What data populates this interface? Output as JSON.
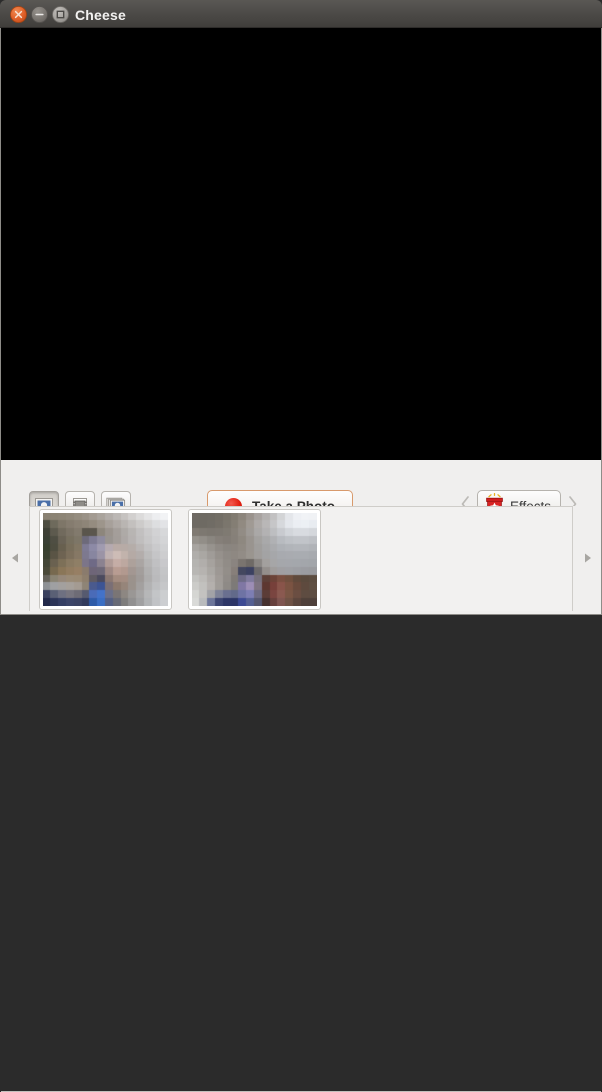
{
  "window": {
    "title": "Cheese",
    "controls": [
      {
        "name": "close",
        "glyph": "×",
        "color": "#e8632a"
      },
      {
        "name": "minimize",
        "glyph": "−",
        "color": "#7d7b77"
      },
      {
        "name": "maximize",
        "glyph": "□",
        "color": "#a9a7a3"
      }
    ]
  },
  "preview": {
    "background_color": "#000000",
    "state": ""
  },
  "toolbar": {
    "modes": [
      {
        "id": "photo",
        "label": "Photo",
        "icon": "photo-icon",
        "active": true
      },
      {
        "id": "video",
        "label": "Video",
        "icon": "video-icon",
        "active": false
      },
      {
        "id": "burst",
        "label": "Burst",
        "icon": "burst-icon",
        "active": false
      }
    ],
    "capture": {
      "label": "Take a Photo",
      "icon": "record-dot-icon",
      "accent_color": "#e21f10",
      "border_color": "#d89a6c"
    },
    "effects": {
      "label": "Effects",
      "icon": "effects-box-icon",
      "prev_icon": "chevron-left-icon",
      "next_icon": "chevron-right-icon"
    }
  },
  "thumbnails": {
    "scroll_left_icon": "triangle-left-icon",
    "scroll_right_icon": "triangle-right-icon",
    "items": [
      {
        "name": "photo-thumbnail-1",
        "cols": 16,
        "rows": 12,
        "pixels": [
          "8a8273",
          "8b8374",
          "8d8576",
          "90887a",
          "958d80",
          "9a9287",
          "a39b92",
          "aaa49d",
          "b3aeaa",
          "bcb8b5",
          "c6c3c1",
          "d2d0cf",
          "dcdbdb",
          "e5e5e6",
          "edeef0",
          "f2f3f5",
          "4c4d41",
          "6e6a5c",
          "7e7668",
          "857c6f",
          "8a8174",
          "8e8578",
          "958c80",
          "9d958b",
          "a7a09a",
          "b0aaa6",
          "b9b5b2",
          "c3c0be",
          "cdcbca",
          "d6d5d5",
          "dddee0",
          "e2e3e6",
          "3d4036",
          "5d5a4e",
          "716a5d",
          "7b7366",
          "827a6d",
          "5a554c",
          "5b564d",
          "8d867c",
          "9a938d",
          "a49e9a",
          "aeaaa7",
          "b8b5b3",
          "c2c0c0",
          "cbcacb",
          "d2d2d4",
          "d7d8da",
          "394035",
          "4f4e43",
          "6a6356",
          "77705f",
          "7d7667",
          "6d6a7a",
          "7d7a92",
          "8e8b9f",
          "999490",
          "a39d99",
          "ada8a6",
          "b7b3b2",
          "c0bebe",
          "c8c7c8",
          "cfcfd1",
          "d4d5d7",
          "37402f",
          "4e4d40",
          "68604f",
          "786e5b",
          "827764",
          "7e7b94",
          "8d8aa6",
          "a09bb0",
          "b5aab0",
          "b9aba6",
          "b7aba6",
          "b5ada9",
          "bab6b5",
          "c2c1c2",
          "cacacc",
          "d0d1d3",
          "3a4131",
          "5a5445",
          "6e6352",
          "7c6f5c",
          "867865",
          "7d798f",
          "8886a0",
          "9b94a6",
          "c0b2b2",
          "cdbcb6",
          "c2b3ac",
          "b5aaa5",
          "b3adab",
          "bcbbbb",
          "c5c5c7",
          "cdcdcf",
          "434637",
          "6a6150",
          "7d7058",
          "897a62",
          "8f7f66",
          "7c7589",
          "6f6a86",
          "8b8290",
          "b09b97",
          "c5ada6",
          "bda8a0",
          "ada19b",
          "aaa5a3",
          "b6b5b5",
          "c0c0c2",
          "c8c8cb",
          "4a4a3a",
          "77694f",
          "8a7658",
          "927c60",
          "977f64",
          "8a7b6d",
          "6e6578",
          "6e6878",
          "9e8884",
          "b89c92",
          "b2998f",
          "a39792",
          "a39e9c",
          "b1b0b0",
          "bcbcbe",
          "c4c5c7",
          "66645c",
          "8a8474",
          "96887a",
          "9a8b77",
          "9a8a74",
          "8e7f6d",
          "5f5a62",
          "4b4a5e",
          "8b7872",
          "a48c80",
          "a48d82",
          "9b928c",
          "a09b99",
          "aeadad",
          "bababc",
          "c2c3c5",
          "8e9296",
          "9fa0a2",
          "a3a09e",
          "a6a09a",
          "a49b92",
          "8e8476",
          "4a5a8e",
          "3d5494",
          "7a6f76",
          "8d7a6e",
          "96857a",
          "9a928c",
          "a3a09f",
          "b2b2b3",
          "bebfc1",
          "c6c7c9",
          "3a4160",
          "5a6075",
          "6e7081",
          "77757f",
          "6e6c76",
          "565a6f",
          "4a6bb8",
          "4372c9",
          "6a6f8a",
          "7a7575",
          "8d8782",
          "9a9795",
          "a6a5a5",
          "b6b7b8",
          "c3c5c7",
          "ccced0",
          "22294a",
          "2c3558",
          "343e63",
          "3b4468",
          "3a4263",
          "313a5c",
          "2e5ba8",
          "3a6ec4",
          "535f84",
          "676a76",
          "7e7d7c",
          "919090",
          "a0a0a1",
          "b2b4b6",
          "c1c3c6",
          "ccced1"
        ]
      },
      {
        "name": "photo-thumbnail-2",
        "cols": 16,
        "rows": 12,
        "pixels": [
          "6f6a64",
          "6e6a63",
          "6f6b64",
          "726e66",
          "78736a",
          "807a70",
          "8c857c",
          "9a938d",
          "a8a3a0",
          "b4b1b0",
          "c2c1c2",
          "d3d4d6",
          "e4e6ea",
          "eef0f4",
          "f1f3f6",
          "f0f2f5",
          "6e6a64",
          "6e6a63",
          "706c65",
          "746f67",
          "7b766d",
          "847e74",
          "918a81",
          "a09a94",
          "aeaaa8",
          "b9b7b7",
          "c6c6c8",
          "d6d8dc",
          "e4e7ec",
          "ebeef3",
          "ecf0f4",
          "e8ecf1",
          "807a73",
          "7d7871",
          "7b766f",
          "7c7770",
          "7f7a72",
          "878179",
          "928c85",
          "9e9a96",
          "aaa8a7",
          "b3b2b3",
          "bdbec1",
          "c8cacf",
          "d2d5da",
          "d8dbe0",
          "d8dbe0",
          "d4d7dc",
          "97938d",
          "928e88",
          "8a8680",
          "857f79",
          "827c76",
          "868079",
          "8e8880",
          "99948f",
          "a3a19f",
          "a9a9aa",
          "b0b1b4",
          "b8bbc0",
          "bec1c6",
          "c1c4c9",
          "c1c4c9",
          "bdc0c5",
          "a8a5a1",
          "a19e99",
          "97938e",
          "8f8a85",
          "8a8580",
          "8b857f",
          "908a83",
          "99948f",
          "a09e9c",
          "a5a5a6",
          "aaabae",
          "aeb1b6",
          "b1b4b9",
          "b3b6bb",
          "b3b6bb",
          "b0b3b8",
          "b0aeab",
          "aaa7a3",
          "a09c98",
          "96918c",
          "8f8a85",
          "8e8882",
          "928c86",
          "9a958f",
          "a09d9b",
          "a3a3a4",
          "a6a7aa",
          "a8aaaf",
          "a9abb0",
          "a9acb1",
          "a9acb1",
          "a7aaaf",
          "b5b4b1",
          "b1aeab",
          "a6a29e",
          "9a9590",
          "918c87",
          "8a8480",
          "7a746f",
          "6f6a66",
          "8b8784",
          "a3a09e",
          "a6a6a7",
          "a5a7ab",
          "a5a7ac",
          "a4a7ac",
          "a3a6ab",
          "a2a5aa",
          "b8b7b4",
          "b6b3b0",
          "aaa7a3",
          "9d9894",
          "938e89",
          "877f7a",
          "43475f",
          "3c4161",
          "6d6a6c",
          "948f8c",
          "a09d9c",
          "a09fa2",
          "9fa0a4",
          "9d9ea3",
          "9b9ca1",
          "9a9b9f",
          "c4c4c1",
          "bdbbb8",
          "b0aca9",
          "a09b97",
          "918c88",
          "7f7a76",
          "6d6a86",
          "7f7a9d",
          "77717d",
          "5d4038",
          "6c4338",
          "7a4f41",
          "70503f",
          "604a3c",
          "5a4a3d",
          "5c4d40",
          "ccccc9",
          "c2c1be",
          "b4b0ad",
          "a09c98",
          "8e8a86",
          "7d7a78",
          "8077a4",
          "9d8eb6",
          "7e7482",
          "5d3730",
          "77403a",
          "89544a",
          "7b5342",
          "6a4b3d",
          "5e4a3e",
          "5f4f42",
          "d5d6d3",
          "c3c2c0",
          "a2a3a7",
          "7e8398",
          "6a7090",
          "626a8a",
          "6e73a4",
          "7d7eb3",
          "6d6a82",
          "5b3c37",
          "7a4540",
          "8a5950",
          "7a5645",
          "6b4e42",
          "5e4c41",
          "5d4d42",
          "d9dad8",
          "b9bbbd",
          "6c7599",
          "3c4572",
          "2d3666",
          "2c3566",
          "3d4a93",
          "556093",
          "54566f",
          "46312f",
          "67403c",
          "7f5550",
          "6f5245",
          "5c463d",
          "4f403a",
          "4e403a"
        ]
      }
    ]
  }
}
